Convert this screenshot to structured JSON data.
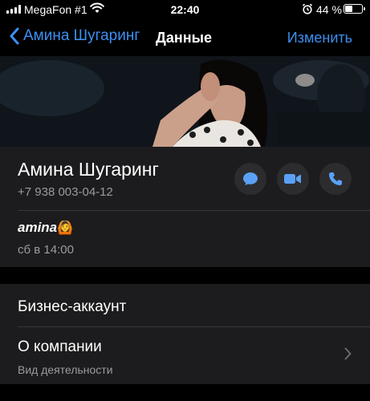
{
  "status_bar": {
    "carrier": "MegaFon #1",
    "time": "22:40",
    "battery_percent": "44 %",
    "battery_level": 0.44,
    "icons": [
      "signal-icon",
      "wifi-icon",
      "alarm-icon",
      "battery-icon"
    ]
  },
  "nav": {
    "back_label": "Амина Шугаринг",
    "title": "Данные",
    "edit_label": "Изменить"
  },
  "contact": {
    "name": "Амина Шугаринг",
    "phone": "+7 938 003-04-12",
    "actions": [
      "message-icon",
      "video-call-icon",
      "phone-icon"
    ],
    "status_text": "amina",
    "status_emoji": "🙆",
    "status_date": "сб в 14:00"
  },
  "business": {
    "header": "Бизнес-аккаунт",
    "about_title": "О компании",
    "about_subtitle": "Вид деятельности"
  },
  "colors": {
    "accent": "#3d8ff2",
    "icon_accent": "#5aa1f6",
    "card_bg": "#1c1c1e",
    "secondary_text": "#9a9aa0"
  }
}
